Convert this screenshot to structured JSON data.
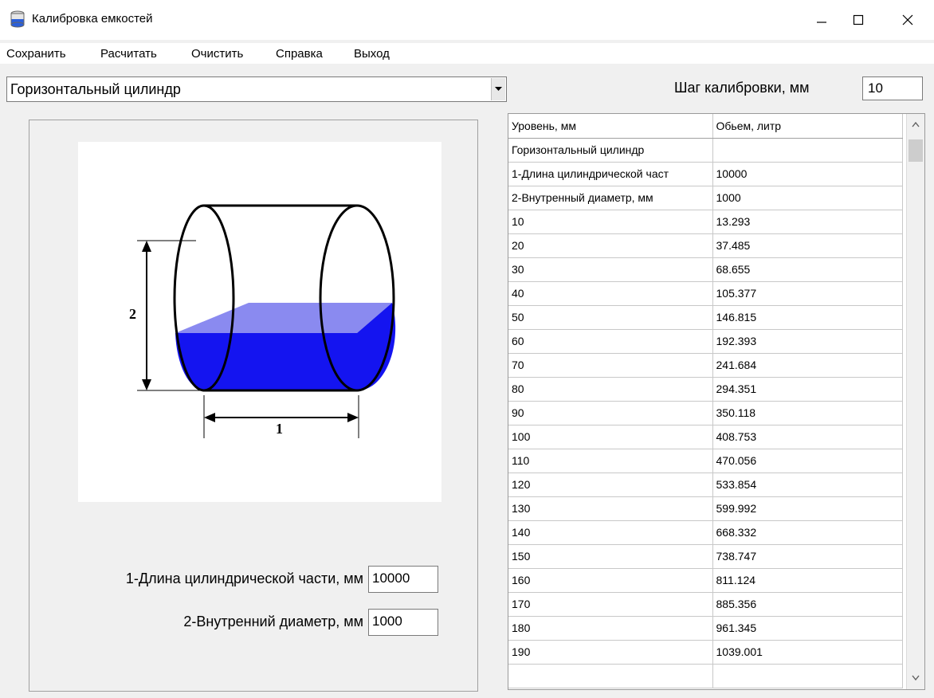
{
  "window": {
    "title": "Калибровка емкостей",
    "minimize": "—",
    "maximize": "☐",
    "close": "✕"
  },
  "menu": [
    "Сохранить",
    "Расчитать",
    "Очистить",
    "Справка",
    "Выход"
  ],
  "tank_type": {
    "selected": "Горизонтальный цилиндр"
  },
  "step": {
    "label": "Шаг калибровки, мм",
    "value": "10"
  },
  "diagram": {
    "label_length": "1",
    "label_diameter": "2"
  },
  "fields": {
    "length_label": "1-Длина цилиндрической части, мм",
    "length_value": "10000",
    "diameter_label": "2-Внутренний диаметр, мм",
    "diameter_value": "1000"
  },
  "table": {
    "headers": [
      "Уровень, мм",
      "Обьем, литр"
    ],
    "rows": [
      [
        "Горизонтальный цилиндр",
        ""
      ],
      [
        "1-Длина цилиндрической част",
        "10000"
      ],
      [
        "2-Внутренный диаметр, мм",
        "1000"
      ],
      [
        "10",
        "13.293"
      ],
      [
        "20",
        "37.485"
      ],
      [
        "30",
        "68.655"
      ],
      [
        "40",
        "105.377"
      ],
      [
        "50",
        "146.815"
      ],
      [
        "60",
        "192.393"
      ],
      [
        "70",
        "241.684"
      ],
      [
        "80",
        "294.351"
      ],
      [
        "90",
        "350.118"
      ],
      [
        "100",
        "408.753"
      ],
      [
        "110",
        "470.056"
      ],
      [
        "120",
        "533.854"
      ],
      [
        "130",
        "599.992"
      ],
      [
        "140",
        "668.332"
      ],
      [
        "150",
        "738.747"
      ],
      [
        "160",
        "811.124"
      ],
      [
        "170",
        "885.356"
      ],
      [
        "180",
        "961.345"
      ],
      [
        "190",
        "1039.001"
      ],
      [
        "",
        ""
      ]
    ]
  }
}
